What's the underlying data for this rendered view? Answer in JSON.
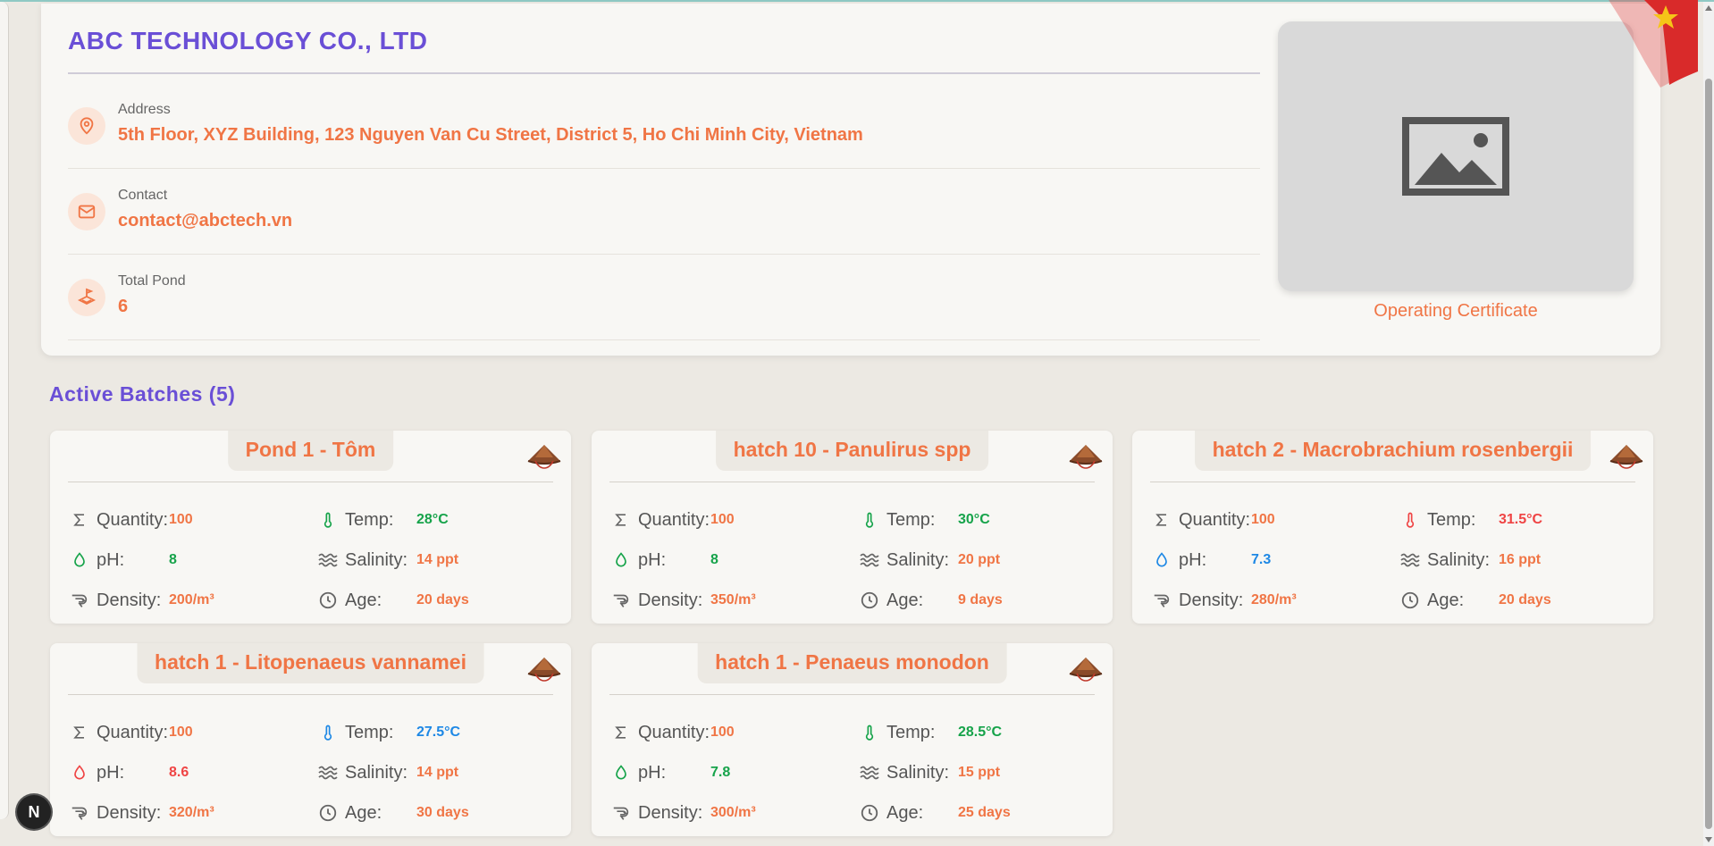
{
  "company": {
    "name": "ABC TECHNOLOGY CO., LTD",
    "address_label": "Address",
    "address_value": "5th Floor, XYZ Building, 123 Nguyen Van Cu Street, District 5, Ho Chi Minh City, Vietnam",
    "contact_label": "Contact",
    "contact_value": "contact@abctech.vn",
    "pond_label": "Total Pond",
    "pond_value": "6",
    "certificate_label": "Operating Certificate"
  },
  "section": {
    "title": "Active Batches (5)"
  },
  "labels": {
    "quantity": "Quantity:",
    "temp": "Temp:",
    "ph": "pH:",
    "salinity": "Salinity:",
    "density": "Density:",
    "age": "Age:"
  },
  "batches": [
    {
      "title": "Pond 1 - Tôm",
      "quantity": "100",
      "temp": "28°C",
      "ph": "8",
      "salinity": "14 ppt",
      "density": "200/m³",
      "age": "20 days",
      "temp_color": "#16a34a",
      "ph_color": "#16a34a"
    },
    {
      "title": "hatch 10 - Panulirus spp",
      "quantity": "100",
      "temp": "30°C",
      "ph": "8",
      "salinity": "20 ppt",
      "density": "350/m³",
      "age": "9 days",
      "temp_color": "#16a34a",
      "ph_color": "#16a34a"
    },
    {
      "title": "hatch 2 - Macrobrachium rosenbergii",
      "quantity": "100",
      "temp": "31.5°C",
      "ph": "7.3",
      "salinity": "16 ppt",
      "density": "280/m³",
      "age": "20 days",
      "temp_color": "#ef4444",
      "ph_color": "#1e88e5"
    },
    {
      "title": "hatch 1 - Litopenaeus vannamei",
      "quantity": "100",
      "temp": "27.5°C",
      "ph": "8.6",
      "salinity": "14 ppt",
      "density": "320/m³",
      "age": "30 days",
      "temp_color": "#1e88e5",
      "ph_color": "#ef4444"
    },
    {
      "title": "hatch 1 - Penaeus monodon",
      "quantity": "100",
      "temp": "28.5°C",
      "ph": "7.8",
      "salinity": "15 ppt",
      "density": "300/m³",
      "age": "25 days",
      "temp_color": "#16a34a",
      "ph_color": "#16a34a"
    }
  ],
  "colors": {
    "accent": "#f07545",
    "heading": "#6a4fd6",
    "good": "#16a34a",
    "warn": "#ef4444",
    "cool": "#1e88e5"
  },
  "icons": [
    "location-pin-icon",
    "mail-icon",
    "pond-icon",
    "image-placeholder-icon",
    "conical-hat-icon",
    "sigma-icon",
    "thermometer-icon",
    "drop-icon",
    "waves-icon",
    "shrimp-icon",
    "clock-icon"
  ],
  "badge": {
    "text": "N"
  }
}
